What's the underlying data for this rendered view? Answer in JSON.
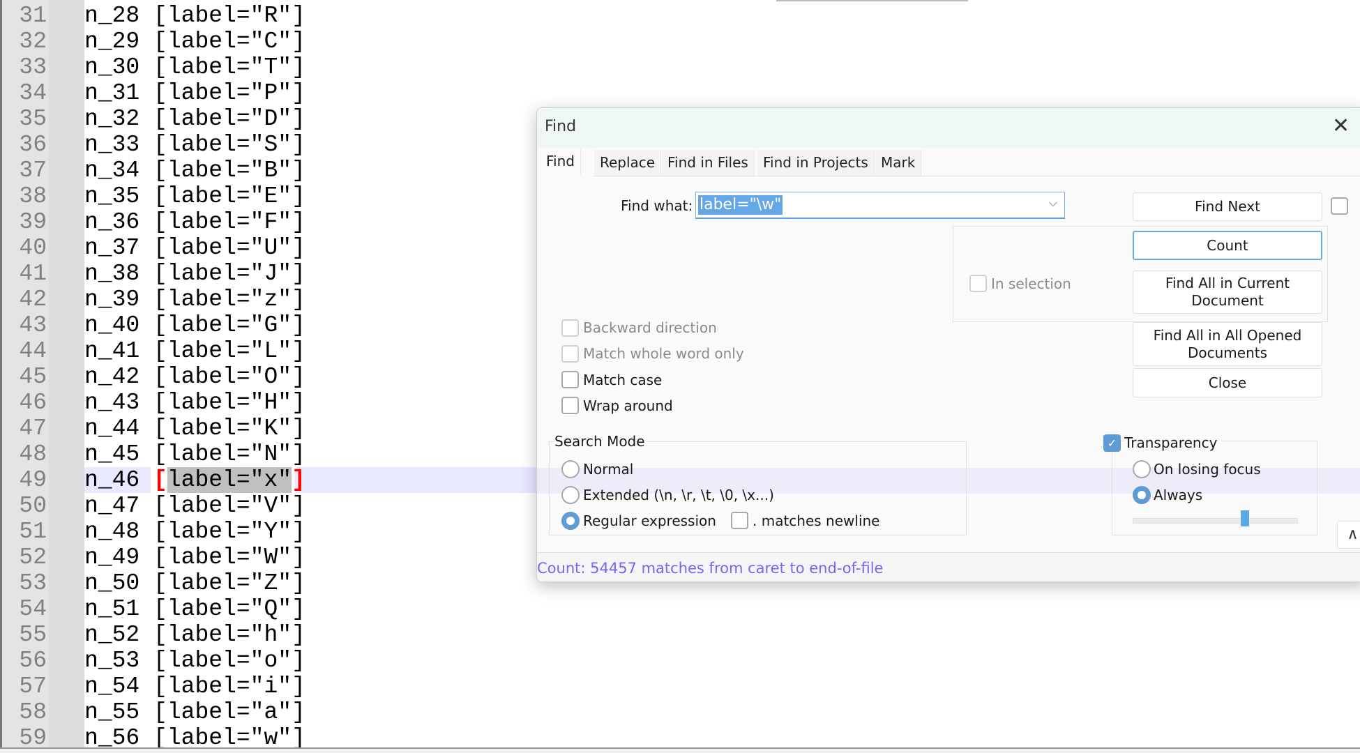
{
  "editor": {
    "current_line": 49,
    "lines": [
      {
        "num": "31",
        "node": "n_28",
        "label": "R"
      },
      {
        "num": "32",
        "node": "n_29",
        "label": "C"
      },
      {
        "num": "33",
        "node": "n_30",
        "label": "T"
      },
      {
        "num": "34",
        "node": "n_31",
        "label": "P"
      },
      {
        "num": "35",
        "node": "n_32",
        "label": "D"
      },
      {
        "num": "36",
        "node": "n_33",
        "label": "S"
      },
      {
        "num": "37",
        "node": "n_34",
        "label": "B"
      },
      {
        "num": "38",
        "node": "n_35",
        "label": "E"
      },
      {
        "num": "39",
        "node": "n_36",
        "label": "F"
      },
      {
        "num": "40",
        "node": "n_37",
        "label": "U"
      },
      {
        "num": "41",
        "node": "n_38",
        "label": "J"
      },
      {
        "num": "42",
        "node": "n_39",
        "label": "z"
      },
      {
        "num": "43",
        "node": "n_40",
        "label": "G"
      },
      {
        "num": "44",
        "node": "n_41",
        "label": "L"
      },
      {
        "num": "45",
        "node": "n_42",
        "label": "O"
      },
      {
        "num": "46",
        "node": "n_43",
        "label": "H"
      },
      {
        "num": "47",
        "node": "n_44",
        "label": "K"
      },
      {
        "num": "48",
        "node": "n_45",
        "label": "N"
      },
      {
        "num": "49",
        "node": "n_46",
        "label": "x"
      },
      {
        "num": "50",
        "node": "n_47",
        "label": "V"
      },
      {
        "num": "51",
        "node": "n_48",
        "label": "Y"
      },
      {
        "num": "52",
        "node": "n_49",
        "label": "W"
      },
      {
        "num": "53",
        "node": "n_50",
        "label": "Z"
      },
      {
        "num": "54",
        "node": "n_51",
        "label": "Q"
      },
      {
        "num": "55",
        "node": "n_52",
        "label": "h"
      },
      {
        "num": "56",
        "node": "n_53",
        "label": "o"
      },
      {
        "num": "57",
        "node": "n_54",
        "label": "i"
      },
      {
        "num": "58",
        "node": "n_55",
        "label": "a"
      },
      {
        "num": "59",
        "node": "n_56",
        "label": "w"
      }
    ]
  },
  "dialog": {
    "title": "Find",
    "close_icon": "close-icon",
    "tabs": [
      "Find",
      "Replace",
      "Find in Files",
      "Find in Projects",
      "Mark"
    ],
    "active_tab": "Find",
    "find_what_label": "Find what:",
    "find_what_value": "label=\"\\w\"",
    "buttons": {
      "find_next": "Find Next",
      "count": "Count",
      "find_all_current": "Find All in Current Document",
      "find_all_opened": "Find All in All Opened Documents",
      "close": "Close"
    },
    "in_selection": {
      "label": "In selection",
      "checked": false,
      "enabled": false
    },
    "options": {
      "backward": {
        "label": "Backward direction",
        "checked": false,
        "enabled": false
      },
      "whole_word": {
        "label": "Match whole word only",
        "checked": false,
        "enabled": false
      },
      "match_case": {
        "label": "Match case",
        "checked": false
      },
      "wrap_around": {
        "label": "Wrap around",
        "checked": false
      }
    },
    "search_mode": {
      "title": "Search Mode",
      "normal": "Normal",
      "extended": "Extended (\\n, \\r, \\t, \\0, \\x...)",
      "regex": "Regular expression",
      "selected": "regex",
      "dot_newline": {
        "label": ". matches newline",
        "checked": false
      }
    },
    "transparency": {
      "label": "Transparency",
      "checked": true,
      "on_losing_focus": "On losing focus",
      "always": "Always",
      "selected": "always",
      "level_percent": 68
    },
    "status": "Count: 54457 matches from caret to end-of-file",
    "colors": {
      "accent": "#5f9bd6",
      "status": "#7a63f5",
      "brace": "#ff0000"
    }
  }
}
